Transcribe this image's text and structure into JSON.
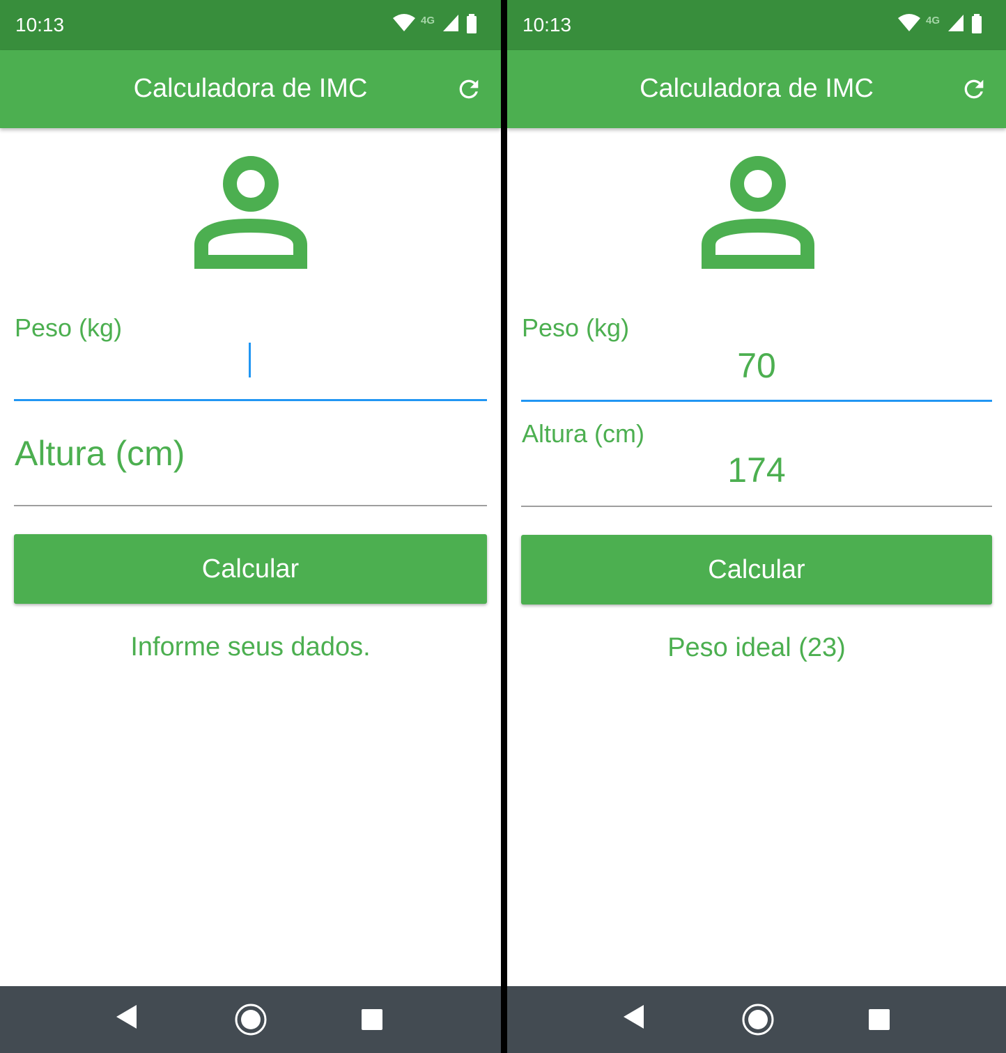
{
  "left": {
    "status_time": "10:13",
    "network_label": "4G",
    "title": "Calculadora de IMC",
    "weight_label": "Peso (kg)",
    "height_placeholder": "Altura (cm)",
    "button_label": "Calcular",
    "result": "Informe seus dados."
  },
  "right": {
    "status_time": "10:13",
    "network_label": "4G",
    "title": "Calculadora de IMC",
    "weight_label": "Peso (kg)",
    "weight_value": "70",
    "height_label": "Altura (cm)",
    "height_value": "174",
    "button_label": "Calcular",
    "result": "Peso ideal (23)"
  },
  "icons": {
    "refresh": "refresh-icon",
    "avatar": "person-outline-icon",
    "wifi": "wifi-icon",
    "signal": "signal-icon",
    "battery": "battery-icon",
    "back": "back-triangle-icon",
    "home": "home-circle-icon",
    "recents": "recents-square-icon"
  },
  "colors": {
    "status_bar": "#388e3c",
    "app_bar": "#4caf50",
    "accent_text": "#4caf50",
    "focus_underline": "#2196f3",
    "nav_bar": "#434b52"
  }
}
